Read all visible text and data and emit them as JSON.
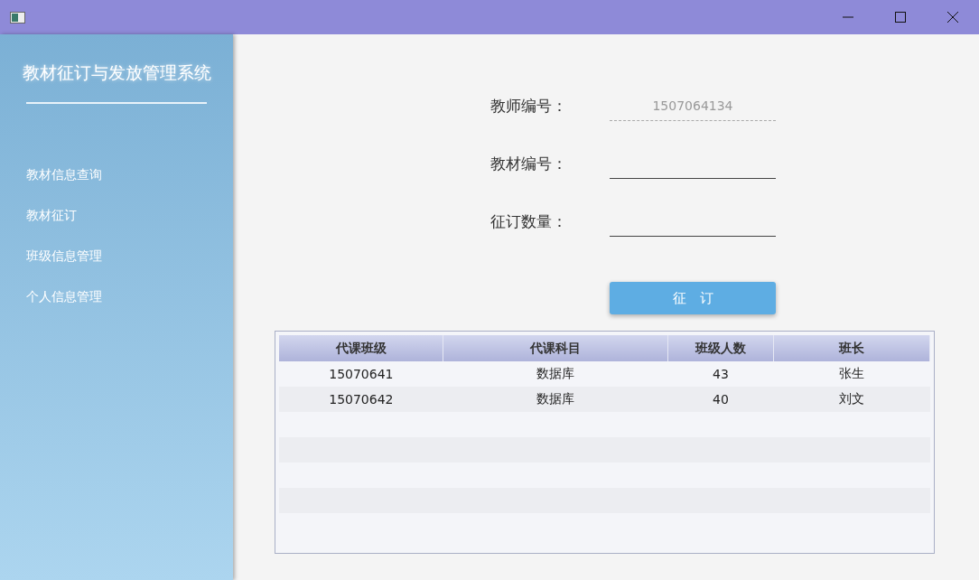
{
  "sidebar": {
    "title": "教材征订与发放管理系统",
    "items": [
      {
        "label": "教材信息查询",
        "selected": false
      },
      {
        "label": "教材征订",
        "selected": false
      },
      {
        "label": "班级信息管理",
        "selected": false
      },
      {
        "label": "个人信息管理",
        "selected": false
      }
    ]
  },
  "form": {
    "fields": [
      {
        "label": "教师编号：",
        "value": "1507064134",
        "disabled": true
      },
      {
        "label": "教材编号：",
        "disabled": false
      },
      {
        "label": "征订数量：",
        "disabled": false
      }
    ],
    "submit": "征　订"
  },
  "table": {
    "columns": [
      "代课班级",
      "代课科目",
      "班级人数",
      "班长"
    ],
    "rows": [
      [
        "15070641",
        "数据库",
        "43",
        "张生"
      ],
      [
        "15070642",
        "数据库",
        "40",
        "刘文"
      ]
    ]
  }
}
